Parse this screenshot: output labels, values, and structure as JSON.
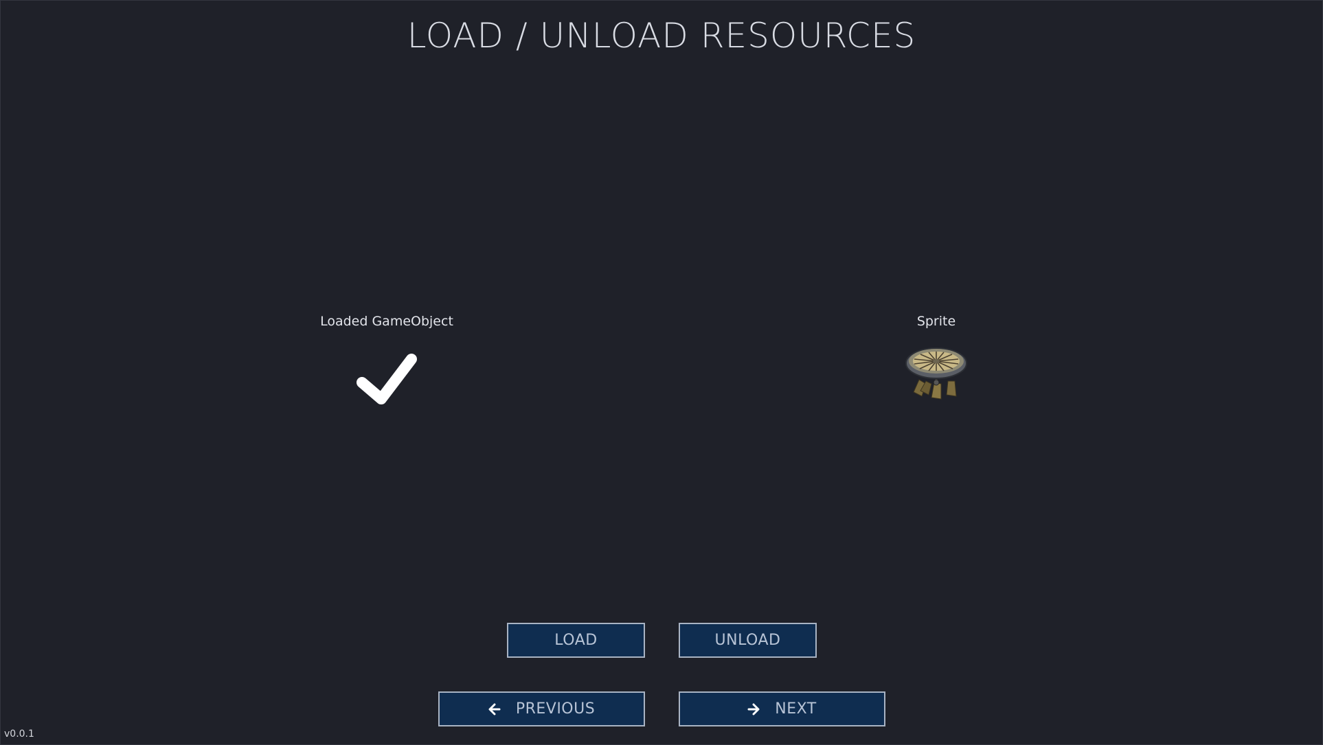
{
  "screen": {
    "title": "LOAD / UNLOAD RESOURCES",
    "version": "v0.0.1"
  },
  "left_panel": {
    "label": "Loaded GameObject",
    "icon": "checkmark-icon",
    "icon_color": "#ffffff"
  },
  "right_panel": {
    "label": "Sprite",
    "image": "sprite-carousel-image"
  },
  "actions": {
    "load_label": "LOAD",
    "unload_label": "UNLOAD"
  },
  "navigation": {
    "previous_label": "PREVIOUS",
    "previous_icon": "arrow-left-icon",
    "next_label": "NEXT",
    "next_icon": "arrow-right-icon"
  },
  "colors": {
    "background": "#1f2129",
    "button_fill": "#0f2d50",
    "button_border": "#a9b4c4",
    "button_text": "#b8c4d6"
  }
}
